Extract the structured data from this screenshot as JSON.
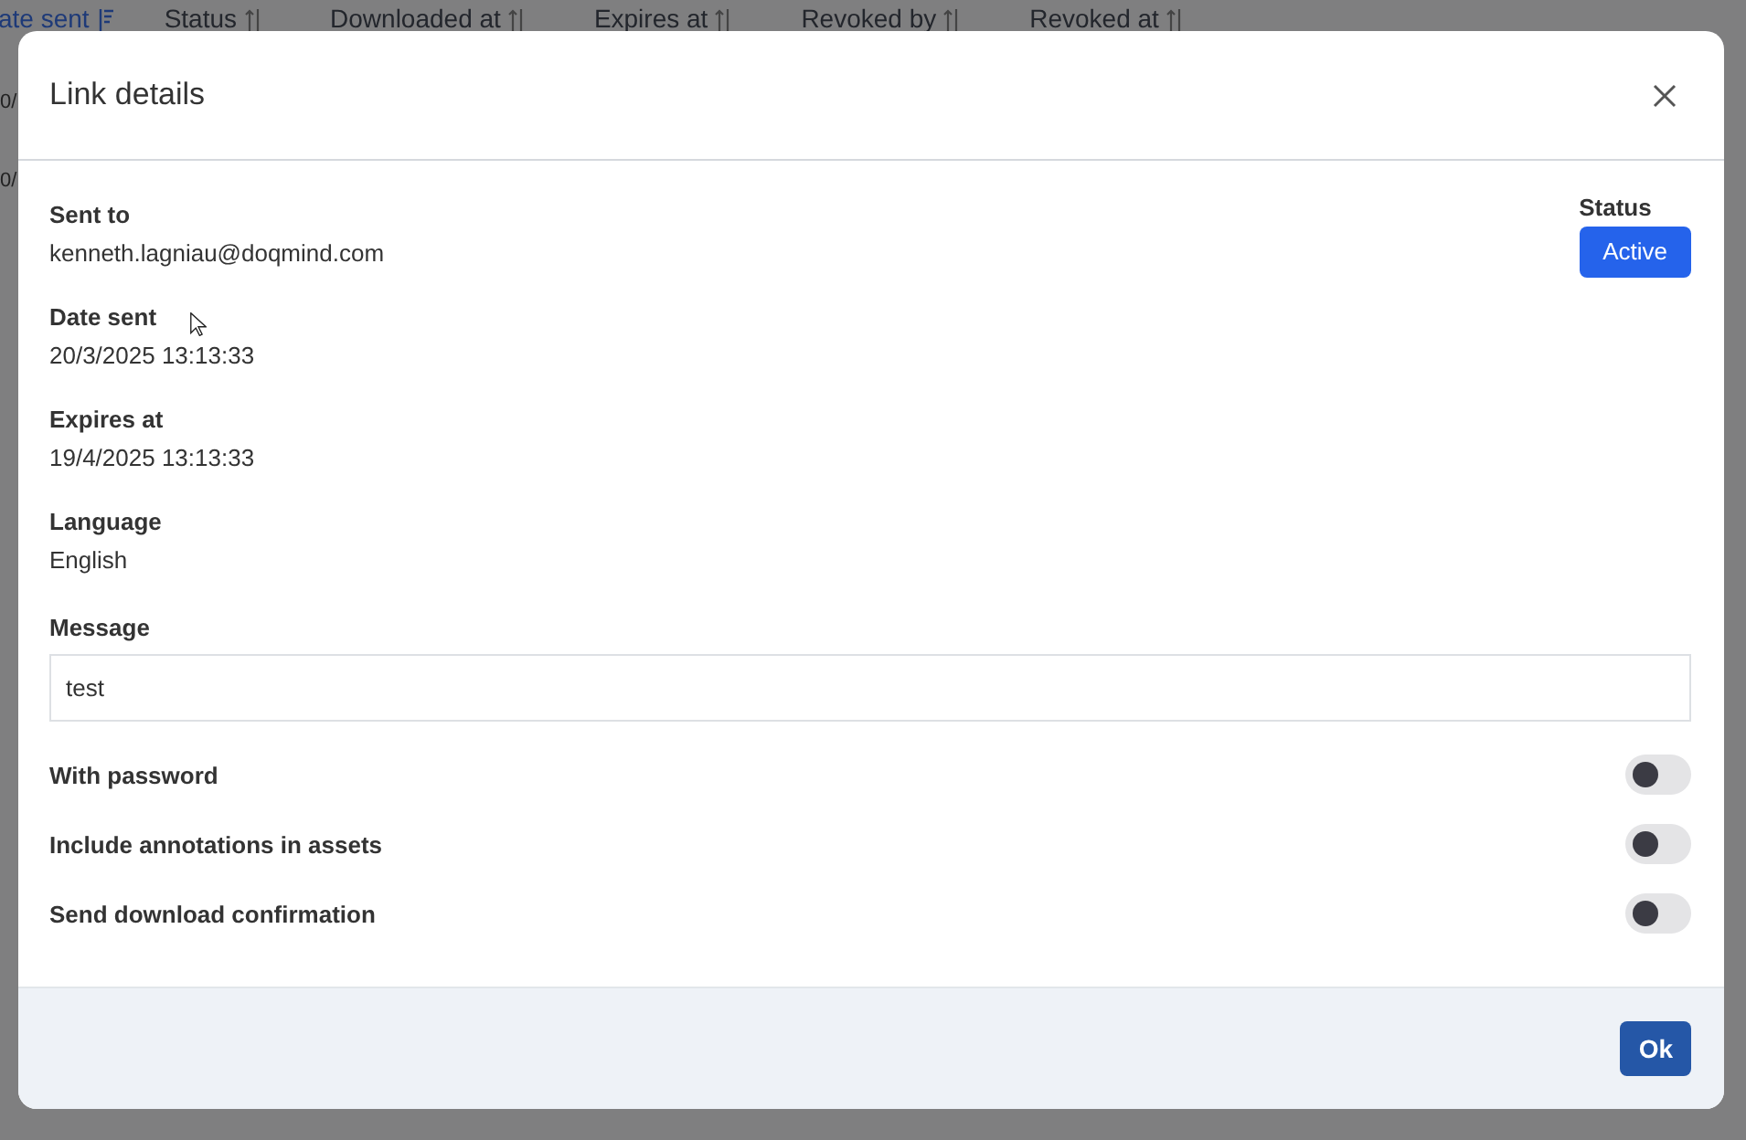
{
  "table": {
    "columns": [
      {
        "label": "ate sent",
        "sorted": true
      },
      {
        "label": "Status",
        "sorted": false
      },
      {
        "label": "Downloaded at",
        "sorted": false
      },
      {
        "label": "Expires at",
        "sorted": false
      },
      {
        "label": "Revoked by",
        "sorted": false
      },
      {
        "label": "Revoked at",
        "sorted": false
      }
    ],
    "rows": [
      "0/",
      "0/"
    ]
  },
  "dialog": {
    "title": "Link details",
    "fields": [
      {
        "label": "Sent to",
        "value": "kenneth.lagniau@doqmind.com"
      },
      {
        "label": "Date sent",
        "value": "20/3/2025 13:13:33"
      },
      {
        "label": "Expires at",
        "value": "19/4/2025 13:13:33"
      },
      {
        "label": "Language",
        "value": "English"
      }
    ],
    "status": {
      "label": "Status",
      "value": "Active"
    },
    "message": {
      "label": "Message",
      "value": "test"
    },
    "toggles": [
      {
        "label": "With password",
        "on": false
      },
      {
        "label": "Include annotations in assets",
        "on": false
      },
      {
        "label": "Send download confirmation",
        "on": false
      }
    ],
    "ok_button": "Ok"
  }
}
